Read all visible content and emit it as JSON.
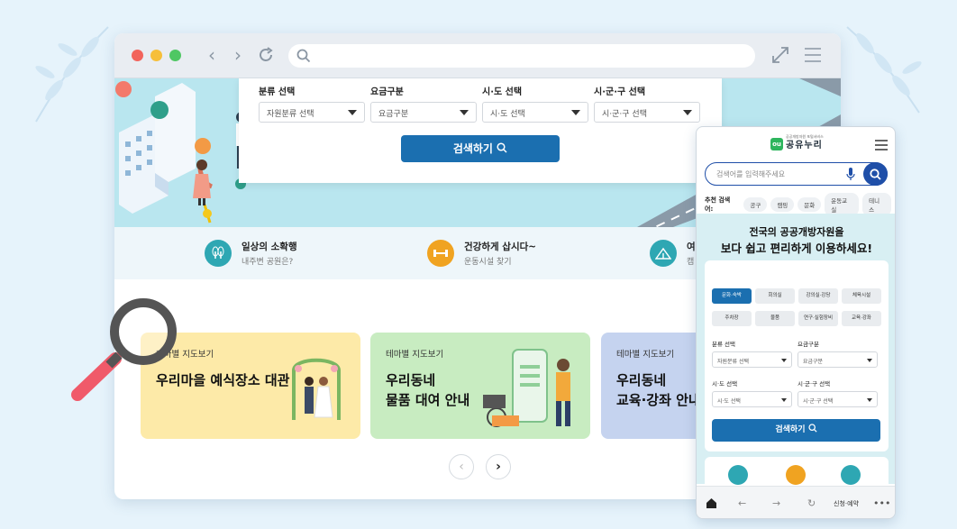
{
  "desktop": {
    "search": {
      "fields": [
        {
          "label": "분류 선택",
          "value": "자원분류 선택"
        },
        {
          "label": "요금구분",
          "value": "요금구분"
        },
        {
          "label": "시·도 선택",
          "value": "시·도 선택"
        },
        {
          "label": "시·군·구 선택",
          "value": "시·군·구 선택"
        }
      ],
      "button": "검색하기"
    },
    "quick": [
      {
        "title": "일상의 소확행",
        "sub": "내주변 공원은?",
        "icon": "park-icon",
        "color": "#2ea7b3"
      },
      {
        "title": "건강하게 삽시다~",
        "sub": "운동시설 찾기",
        "icon": "dumbbell-icon",
        "color": "#f0a321"
      },
      {
        "title": "여",
        "sub": "캠",
        "icon": "tent-icon",
        "color": "#2ea7b3"
      }
    ],
    "cards": [
      {
        "tag": "테마별 지도보기",
        "title": "우리마을 예식장소 대관",
        "color": "#fdeaa8"
      },
      {
        "tag": "테마별 지도보기",
        "title1": "우리동네",
        "title2": "물품 대여 안내",
        "color": "#c8ecc1"
      },
      {
        "tag": "테마별 지도보기",
        "title1": "우리동네",
        "title2": "교육·강좌 안내",
        "color": "#c5d3ef"
      }
    ]
  },
  "mobile": {
    "logo": "공유누리",
    "logo_small": "공공개방자원 포털서비스",
    "search_placeholder": "검색어를 입력해주세요",
    "recommend_label": "추천 검색어:",
    "chips": [
      "공구",
      "캠핑",
      "문화",
      "운동교실",
      "테니스"
    ],
    "headline1": "전국의 공공개방자원을",
    "headline2": "보다 쉽고 편리하게 이용하세요!",
    "tabs": [
      "문화·숙박",
      "회의실",
      "강의실·강당",
      "체육시설",
      "주차장",
      "물품",
      "연구·실험장비",
      "교육·강좌"
    ],
    "fields": [
      {
        "label": "분류 선택",
        "value": "자원분류 선택"
      },
      {
        "label": "요금구분",
        "value": "요금구분"
      },
      {
        "label": "시·도 선택",
        "value": "시·도 선택"
      },
      {
        "label": "시·군·구 선택",
        "value": "시·군·구 선택"
      }
    ],
    "button": "검색하기",
    "bottom_label": "신청·예약"
  }
}
